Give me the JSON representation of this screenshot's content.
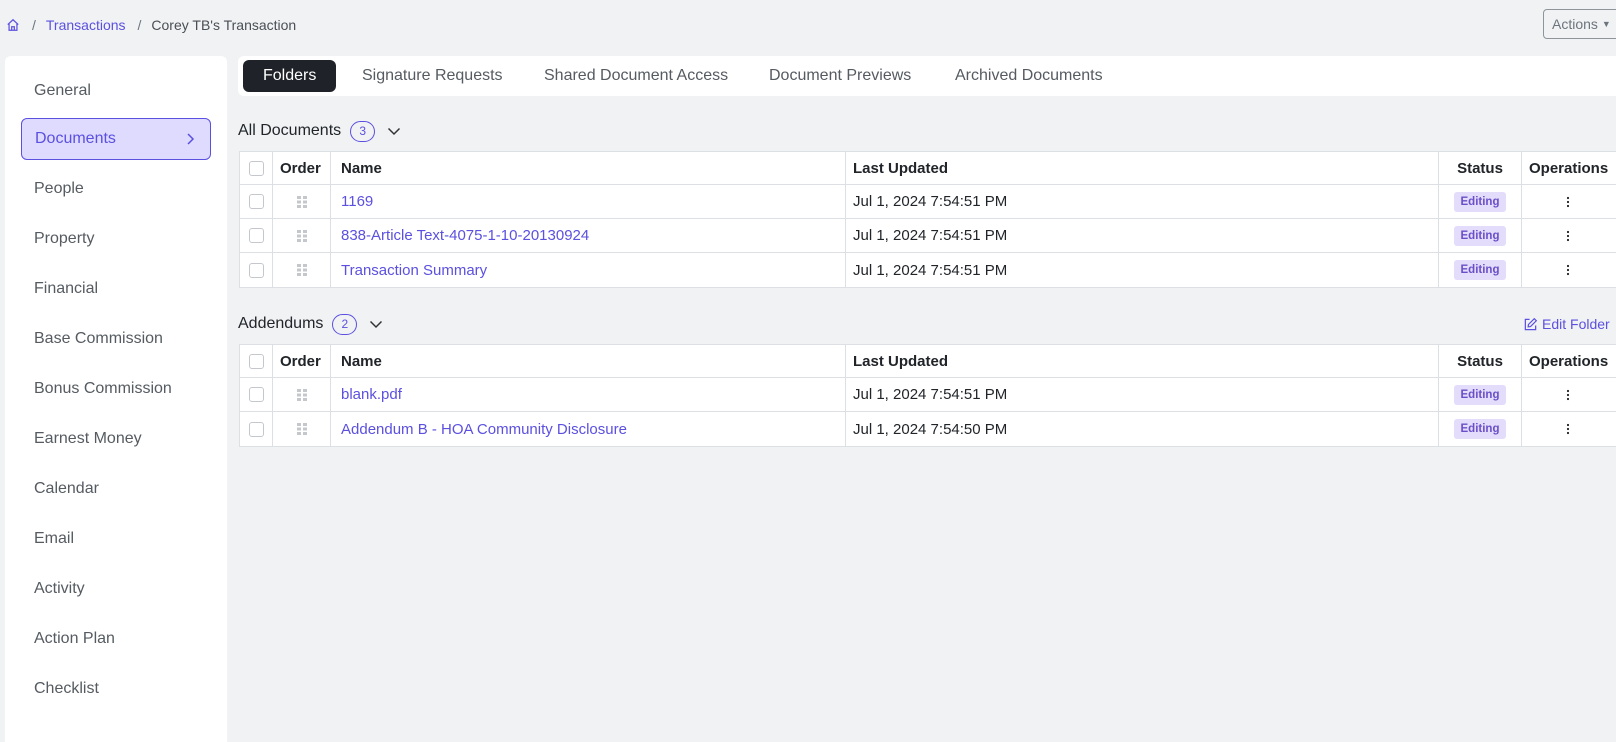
{
  "breadcrumb": {
    "home_icon": "home-icon",
    "items": [
      "Transactions",
      "Corey TB's Transaction"
    ],
    "separator": "/"
  },
  "actions_button": {
    "label": "Actions",
    "icon": "caret-down-icon"
  },
  "sidebar": {
    "items": [
      {
        "label": "General"
      },
      {
        "label": "Documents",
        "active": true
      },
      {
        "label": "People"
      },
      {
        "label": "Property"
      },
      {
        "label": "Financial"
      },
      {
        "label": "Base Commission"
      },
      {
        "label": "Bonus Commission"
      },
      {
        "label": "Earnest Money"
      },
      {
        "label": "Calendar"
      },
      {
        "label": "Email"
      },
      {
        "label": "Activity"
      },
      {
        "label": "Action Plan"
      },
      {
        "label": "Checklist"
      }
    ]
  },
  "tabs": [
    {
      "label": "Folders",
      "active": true
    },
    {
      "label": "Signature Requests"
    },
    {
      "label": "Shared Document Access"
    },
    {
      "label": "Document Previews"
    },
    {
      "label": "Archived Documents"
    }
  ],
  "columns": {
    "order": "Order",
    "name": "Name",
    "last_updated": "Last Updated",
    "status": "Status",
    "operations": "Operations"
  },
  "folders": [
    {
      "title": "All Documents",
      "count": "3",
      "rows": [
        {
          "name": "1169",
          "updated": "Jul 1, 2024 7:54:51 PM",
          "status": "Editing"
        },
        {
          "name": "838-Article Text-4075-1-10-20130924",
          "updated": "Jul 1, 2024 7:54:51 PM",
          "status": "Editing"
        },
        {
          "name": "Transaction Summary",
          "updated": "Jul 1, 2024 7:54:51 PM",
          "status": "Editing"
        }
      ]
    },
    {
      "title": "Addendums",
      "count": "2",
      "edit_label": "Edit Folder",
      "rows": [
        {
          "name": "blank.pdf",
          "updated": "Jul 1, 2024 7:54:51 PM",
          "status": "Editing"
        },
        {
          "name": "Addendum B - HOA Community Disclosure",
          "updated": "Jul 1, 2024 7:54:50 PM",
          "status": "Editing"
        }
      ]
    }
  ],
  "colors": {
    "accent": "#5b50e0",
    "active_tab_bg": "#1f2228",
    "status_badge_bg": "#e3dcfb",
    "page_bg": "#f1f2f4"
  }
}
